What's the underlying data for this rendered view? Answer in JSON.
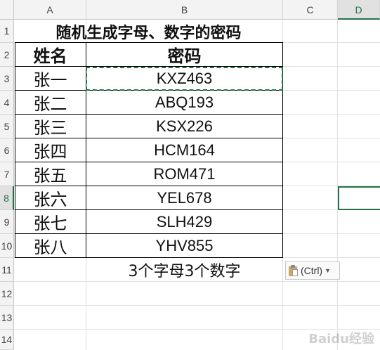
{
  "columns": [
    "A",
    "B",
    "C",
    "D"
  ],
  "rows": [
    "1",
    "2",
    "3",
    "4",
    "5",
    "6",
    "7",
    "8",
    "9",
    "10",
    "11",
    "12",
    "13",
    "14"
  ],
  "title": "随机生成字母、数字的密码",
  "headers": {
    "name": "姓名",
    "password": "密码"
  },
  "records": [
    {
      "name": "张一",
      "password": "KXZ463"
    },
    {
      "name": "张二",
      "password": "ABQ193"
    },
    {
      "name": "张三",
      "password": "KSX226"
    },
    {
      "name": "张四",
      "password": "HCM164"
    },
    {
      "name": "张五",
      "password": "ROM471"
    },
    {
      "name": "张六",
      "password": "YEL678"
    },
    {
      "name": "张七",
      "password": "SLH429"
    },
    {
      "name": "张八",
      "password": "YHV855"
    }
  ],
  "note": "3个字母3个数字",
  "paste_options": {
    "label": "(Ctrl)"
  },
  "watermark": "Baidu经验",
  "colors": {
    "accent": "#217346",
    "header_bg": "#f3f3f3"
  }
}
